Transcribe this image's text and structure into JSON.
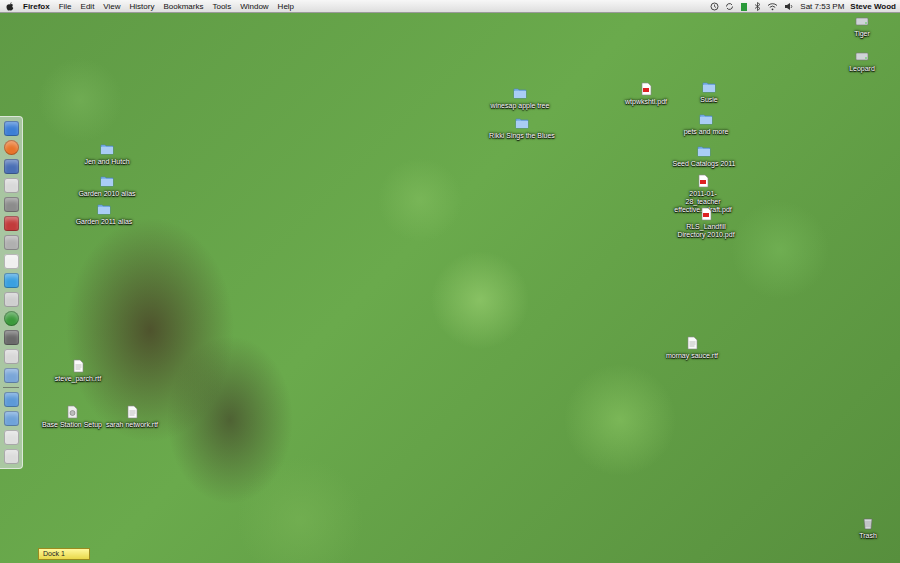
{
  "menu_bar": {
    "app": "Firefox",
    "menus": [
      "File",
      "Edit",
      "View",
      "History",
      "Bookmarks",
      "Tools",
      "Window",
      "Help"
    ],
    "clock": "Sat 7:53 PM",
    "user": "Steve Wood"
  },
  "desktop_icons": [
    {
      "label": "Tiger",
      "kind": "disk"
    },
    {
      "label": "Leopard",
      "kind": "disk"
    },
    {
      "label": "winesap apple tree",
      "kind": "folder"
    },
    {
      "label": "wtpwkshtl.pdf",
      "kind": "pdf"
    },
    {
      "label": "Susie",
      "kind": "folder"
    },
    {
      "label": "Rikki Sings the Blues",
      "kind": "folder"
    },
    {
      "label": "pets and more",
      "kind": "folder"
    },
    {
      "label": "Jen and Hutch",
      "kind": "folder"
    },
    {
      "label": "Seed Catalogs 2011",
      "kind": "folder"
    },
    {
      "label": "2011-01-28_teacher effective...draft.pdf",
      "kind": "pdf"
    },
    {
      "label": "RLS_Landfill Directory 2010.pdf",
      "kind": "pdf"
    },
    {
      "label": "Garden 2010 alias",
      "kind": "folder"
    },
    {
      "label": "Garden 2011 alias",
      "kind": "folder"
    },
    {
      "label": "mornay sauce.rtf",
      "kind": "document"
    },
    {
      "label": "steve_parch.rtf",
      "kind": "document"
    },
    {
      "label": "Base Station Setup",
      "kind": "app"
    },
    {
      "label": "sarah network.rtf",
      "kind": "document"
    },
    {
      "label": "Trash",
      "kind": "trash"
    }
  ],
  "dock_tab": {
    "label": "Dock 1"
  }
}
